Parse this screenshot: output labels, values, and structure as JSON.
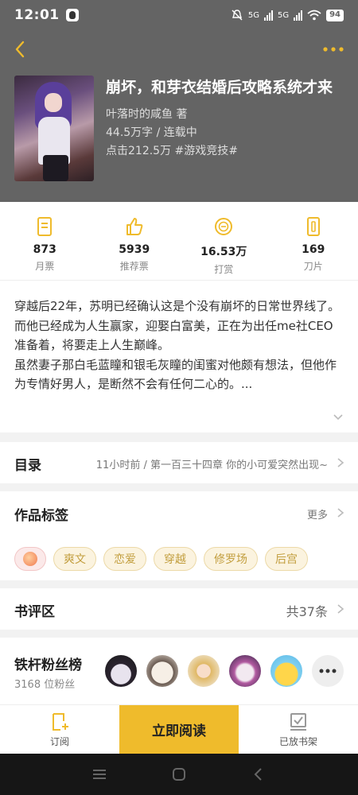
{
  "status_bar": {
    "time": "12:01",
    "signal1": "5G",
    "signal2": "5G",
    "battery": "94"
  },
  "book": {
    "title": "崩坏，和芽衣结婚后攻略系统才来",
    "author_line": "叶落时的咸鱼  著",
    "words_status": "44.5万字 / 连载中",
    "clicks_tag": "点击212.5万  #游戏竞技#"
  },
  "stats": [
    {
      "value": "873",
      "label": "月票",
      "icon": "ticket-icon"
    },
    {
      "value": "5939",
      "label": "推荐票",
      "icon": "thumbs-up-icon"
    },
    {
      "value": "16.53万",
      "label": "打赏",
      "icon": "coin-icon"
    },
    {
      "value": "169",
      "label": "刀片",
      "icon": "blade-icon"
    }
  ],
  "synopsis": [
    "穿越后22年，苏明已经确认这是个没有崩坏的日常世界线了。",
    "而他已经成为人生赢家，迎娶白富美，正在为出任me社CEO",
    "准备着，将要走上人生巅峰。",
    "虽然妻子那白毛蓝瞳和银毛灰瞳的闺蜜对他颇有想法，但他作",
    "为专情好男人，是断然不会有任何二心的。..."
  ],
  "toc": {
    "title": "目录",
    "latest": "11小时前 / 第一百三十四章 你的小可爱突然出现~"
  },
  "tags_section": {
    "title": "作品标签",
    "more": "更多",
    "tags": [
      "爽文",
      "恋爱",
      "穿越",
      "修罗场",
      "后宫"
    ]
  },
  "reviews": {
    "title": "书评区",
    "count": "共37条"
  },
  "fans": {
    "title": "铁杆粉丝榜",
    "count": "3168 位粉丝"
  },
  "bottom_bar": {
    "subscribe": "订阅",
    "read_now": "立即阅读",
    "shelf": "已放书架"
  },
  "colors": {
    "accent": "#efbb2c",
    "header_bg": "#646464",
    "tag_text": "#c29e3e"
  }
}
